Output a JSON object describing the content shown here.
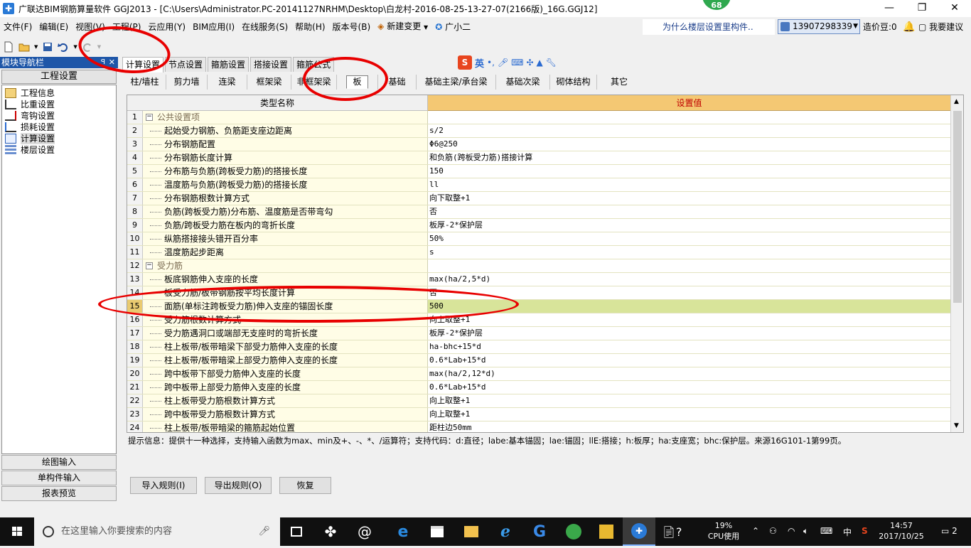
{
  "titlebar": {
    "title": "广联达BIM钢筋算量软件 GGJ2013 - [C:\\Users\\Administrator.PC-20141127NRHM\\Desktop\\白龙村-2016-08-25-13-27-07(2166版)_16G.GGJ12]",
    "badge": "68",
    "minimize": "—",
    "restore": "❐",
    "close": "✕"
  },
  "menubar": {
    "items": [
      "文件(F)",
      "编辑(E)",
      "视图(V)",
      "工程(P)",
      "云应用(Y)",
      "BIM应用(I)",
      "在线服务(S)",
      "帮助(H)",
      "版本号(B)",
      "新建变更",
      "广小二"
    ],
    "marquee": "为什么楼层设置里构件..",
    "user": "13907298339",
    "cost_bean": "造价豆:0",
    "suggest": "我要建议"
  },
  "nav": {
    "header": "模块导航栏",
    "pin": "ꟼ",
    "close": "✕",
    "title": "工程设置",
    "items": [
      "工程信息",
      "比重设置",
      "弯钩设置",
      "损耗设置",
      "计算设置",
      "楼层设置"
    ],
    "selected": 4,
    "bottom_buttons": [
      "绘图输入",
      "单构件输入",
      "报表预览"
    ]
  },
  "tabs1": [
    "计算设置",
    "节点设置",
    "箍筋设置",
    "搭接设置",
    "箍筋公式"
  ],
  "tabs2": [
    "柱/墙柱",
    "剪力墙",
    "连梁",
    "框架梁",
    "非框架梁",
    "板",
    "基础",
    "基础主梁/承台梁",
    "基础次梁",
    "砌体结构",
    "其它"
  ],
  "grid": {
    "header_name": "类型名称",
    "header_value": "设置值",
    "rows": [
      {
        "n": "1",
        "name": "公共设置项",
        "value": "",
        "group": true
      },
      {
        "n": "2",
        "name": "起始受力钢筋、负筋距支座边距离",
        "value": "s/2"
      },
      {
        "n": "3",
        "name": "分布钢筋配置",
        "value": "Φ6@250"
      },
      {
        "n": "4",
        "name": "分布钢筋长度计算",
        "value": "和负筋(跨板受力筋)搭接计算"
      },
      {
        "n": "5",
        "name": "分布筋与负筋(跨板受力筋)的搭接长度",
        "value": "150"
      },
      {
        "n": "6",
        "name": "温度筋与负筋(跨板受力筋)的搭接长度",
        "value": "ll"
      },
      {
        "n": "7",
        "name": "分布钢筋根数计算方式",
        "value": "向下取整+1"
      },
      {
        "n": "8",
        "name": "负筋(跨板受力筋)分布筋、温度筋是否带弯勾",
        "value": "否"
      },
      {
        "n": "9",
        "name": "负筋/跨板受力筋在板内的弯折长度",
        "value": "板厚-2*保护层"
      },
      {
        "n": "10",
        "name": "纵筋搭接接头错开百分率",
        "value": "50%"
      },
      {
        "n": "11",
        "name": "温度筋起步距离",
        "value": "s"
      },
      {
        "n": "12",
        "name": "受力筋",
        "value": "",
        "group": true
      },
      {
        "n": "13",
        "name": "板底钢筋伸入支座的长度",
        "value": "max(ha/2,5*d)"
      },
      {
        "n": "14",
        "name": "板受力筋/板带钢筋按平均长度计算",
        "value": "否"
      },
      {
        "n": "15",
        "name": "面筋(单标注跨板受力筋)伸入支座的锚固长度",
        "value": "500",
        "highlight": true
      },
      {
        "n": "16",
        "name": "受力筋根数计算方式",
        "value": "向上取整+1"
      },
      {
        "n": "17",
        "name": "受力筋遇洞口或端部无支座时的弯折长度",
        "value": "板厚-2*保护层"
      },
      {
        "n": "18",
        "name": "柱上板带/板带暗梁下部受力筋伸入支座的长度",
        "value": "ha-bhc+15*d"
      },
      {
        "n": "19",
        "name": "柱上板带/板带暗梁上部受力筋伸入支座的长度",
        "value": "0.6*Lab+15*d"
      },
      {
        "n": "20",
        "name": "跨中板带下部受力筋伸入支座的长度",
        "value": "max(ha/2,12*d)"
      },
      {
        "n": "21",
        "name": "跨中板带上部受力筋伸入支座的长度",
        "value": "0.6*Lab+15*d"
      },
      {
        "n": "22",
        "name": "柱上板带受力筋根数计算方式",
        "value": "向上取整+1"
      },
      {
        "n": "23",
        "name": "跨中板带受力筋根数计算方式",
        "value": "向上取整+1"
      },
      {
        "n": "24",
        "name": "柱上板带/板带暗梁的箍筋起始位置",
        "value": "距柱边50mm"
      }
    ]
  },
  "hint": "提示信息：提供十一种选择，支持输入函数为max、min及+、-、*、/运算符；支持代码：d:直径；labe:基本锚固；lae:锚固；llE:搭接；h:板厚；ha:支座宽；bhc:保护层。来源16G101-1第99页。",
  "buttons": {
    "import": "导入规则(I)",
    "export": "导出规则(O)",
    "restore": "恢复"
  },
  "ime": {
    "label": "英"
  },
  "taskbar": {
    "search_placeholder": "在这里输入你要搜索的内容",
    "cpu_pct": "19%",
    "cpu_label": "CPU使用",
    "time": "14:57",
    "date": "2017/10/25",
    "ime": "中",
    "notif": "2"
  }
}
